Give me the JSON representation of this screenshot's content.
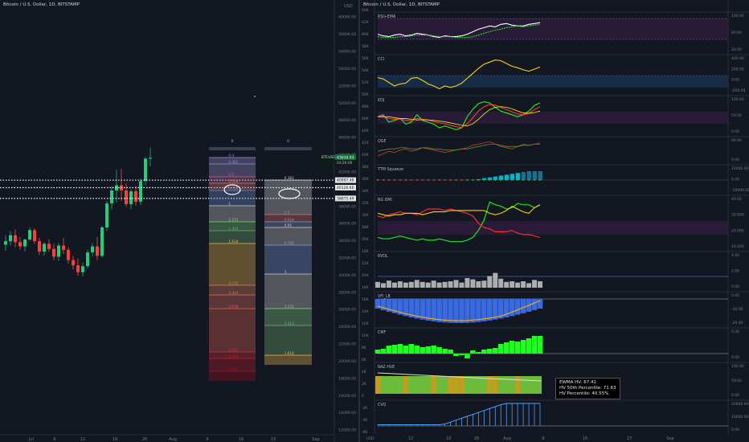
{
  "left_chart": {
    "title": "Bitcoin / U.S. Dollar, 1D, BITSTAMP",
    "currency": "USD",
    "ticker": "BTCUSD",
    "last_price": "43634.93",
    "countdown": "04:26:06",
    "price_tags": [
      "40997.48",
      "40126.60",
      "38875.49"
    ],
    "y_ticks": [
      "60000.00",
      "58000.00",
      "56000.00",
      "54000.00",
      "52000.00",
      "50000.00",
      "48000.00",
      "46000.00",
      "44000.00",
      "42000.00",
      "40000.00",
      "38000.00",
      "36000.00",
      "34000.00",
      "32000.00",
      "30000.00",
      "28000.00",
      "26000.00",
      "24000.00",
      "22000.00",
      "20000.00",
      "18000.00",
      "16000.00",
      "14000.00",
      "12000.00"
    ],
    "x_ticks": [
      "Jul",
      "6",
      "12",
      "19",
      "26",
      "Aug",
      "9",
      "16",
      "23",
      "Sep"
    ],
    "fib_left": {
      "top_label": "0",
      "levels": [
        "0.3",
        "0.382",
        "0.5",
        "0.618",
        "0.786",
        "1",
        "1.272",
        "1.414",
        "1.618",
        "2.272",
        "2.414",
        "2.618",
        "3.272",
        "3.414",
        "3.618"
      ]
    },
    "fib_right": {
      "top_label": "0",
      "levels": [
        "0.382",
        "0.5",
        "0.618",
        "0.65",
        "0.786",
        "1",
        "1.272",
        "1.414",
        "1.618"
      ]
    }
  },
  "right_chart": {
    "title": "Bitcoin / U.S. Dollar, 1D, BITSTAMP",
    "currency": "USD",
    "x_ticks": [
      "12",
      "19",
      "26",
      "Aug",
      "9",
      "16",
      "23",
      "Sep"
    ],
    "left_ticks": [
      "64K",
      "62K",
      "60K",
      "58K",
      "56K",
      "54K",
      "52K",
      "50K",
      "48K",
      "46K",
      "44K",
      "42K",
      "40K",
      "38K",
      "36K",
      "34K",
      "32K",
      "30K",
      "28K",
      "26K",
      "24K",
      "22K",
      "20K",
      "18K",
      "16K",
      "14K",
      "12K",
      "10K",
      "8K",
      "6K",
      "4K",
      "2K",
      "0",
      "-2K",
      "-4K",
      "-6K"
    ],
    "panes": [
      {
        "name": "RSI+EMA",
        "ticks": [
          "100.00",
          "80.00",
          "20.00"
        ]
      },
      {
        "name": "CCI",
        "ticks": [
          "400.00",
          "200.00",
          "0.00",
          "-200.00"
        ]
      },
      {
        "name": "KDJ",
        "ticks": [
          "100.00",
          "50.00",
          "0.00"
        ]
      },
      {
        "name": "OGE",
        "ticks": [
          "60.00",
          "0.00"
        ]
      },
      {
        "name": "TTM Squeeze",
        "ticks": [
          "10000.00",
          "0.00",
          "-10000.00"
        ]
      },
      {
        "name": "RG DMI",
        "ticks": [
          "40.00",
          "30.000",
          "20.000",
          "10.000"
        ]
      },
      {
        "name": "RVOL",
        "ticks": [
          "4.00",
          "2.00",
          "0.00"
        ]
      },
      {
        "name": "VFI_LB",
        "ticks": [
          "0.00",
          "-10.00",
          "-20.00"
        ]
      },
      {
        "name": "CMF",
        "ticks": [
          "0.20",
          "0.00"
        ]
      },
      {
        "name": "RAZ HVE",
        "ticks": [
          "100.00",
          "50.00",
          "0.00"
        ]
      },
      {
        "name": "CVO",
        "ticks": [
          "20000.00",
          "10000.00",
          "0.00"
        ]
      }
    ],
    "hve_box": {
      "line1": "EWMA HV: 67.41",
      "line2": "HV 50th Percentile: 71.63",
      "line3": "HV Percentile: 40.55%"
    }
  },
  "chart_data": [
    {
      "type": "candlestick",
      "title": "Bitcoin / U.S. Dollar, 1D, BITSTAMP",
      "ylim": [
        11500,
        61000
      ],
      "x_categories": [
        "Jul",
        "6",
        "12",
        "19",
        "26",
        "Aug",
        "9",
        "16",
        "23",
        "Sep"
      ],
      "candles": [
        [
          33500,
          34600,
          32800,
          33900
        ],
        [
          33900,
          35100,
          33400,
          34600
        ],
        [
          34600,
          35300,
          33200,
          33800
        ],
        [
          33800,
          34400,
          32900,
          33300
        ],
        [
          33300,
          34200,
          32700,
          34100
        ],
        [
          34100,
          35500,
          33900,
          35200
        ],
        [
          35200,
          35400,
          33600,
          33900
        ],
        [
          33900,
          34300,
          32300,
          32700
        ],
        [
          32700,
          33800,
          32200,
          33600
        ],
        [
          33600,
          34100,
          32700,
          33000
        ],
        [
          33000,
          33600,
          31700,
          32100
        ],
        [
          32100,
          33700,
          31600,
          33400
        ],
        [
          33400,
          34300,
          32400,
          32900
        ],
        [
          32900,
          33200,
          31300,
          31700
        ],
        [
          31700,
          32200,
          30600,
          31100
        ],
        [
          31100,
          31900,
          29900,
          30300
        ],
        [
          30300,
          31400,
          29800,
          31000
        ],
        [
          31000,
          32900,
          30700,
          32600
        ],
        [
          32600,
          33700,
          32100,
          33300
        ],
        [
          33300,
          34400,
          31700,
          32200
        ],
        [
          32200,
          35700,
          32000,
          35500
        ],
        [
          35500,
          38600,
          35100,
          38300
        ],
        [
          38300,
          40300,
          37600,
          39800
        ],
        [
          39800,
          42200,
          38400,
          40400
        ],
        [
          40400,
          42300,
          38600,
          39800
        ],
        [
          39800,
          40600,
          37900,
          38200
        ],
        [
          38200,
          39900,
          37600,
          39700
        ],
        [
          39700,
          40300,
          38000,
          38500
        ],
        [
          38500,
          41200,
          38100,
          40900
        ],
        [
          40900,
          43700,
          40400,
          43500
        ],
        [
          43500,
          44800,
          42600,
          43600
        ]
      ],
      "horizontal_levels": [
        40997.48,
        40126.6,
        38875.49
      ],
      "last_price": 43634.93
    },
    {
      "type": "line",
      "title": "RSI+EMA",
      "series": [
        {
          "values": [
            60,
            58,
            57,
            59,
            60,
            58,
            59,
            61,
            60,
            59,
            57,
            56,
            58,
            57,
            57,
            58,
            60,
            63,
            66,
            68,
            70,
            69,
            72,
            73,
            71,
            70,
            70,
            72,
            73,
            74
          ]
        },
        {
          "values": [
            57,
            56,
            56,
            56,
            57,
            57,
            58,
            59,
            59,
            59,
            58,
            57,
            57,
            57,
            56,
            56,
            56,
            57,
            59,
            61,
            63,
            65,
            66,
            68,
            69,
            70,
            69,
            70,
            71,
            72
          ]
        }
      ]
    },
    {
      "type": "line",
      "title": "CCI",
      "series": [
        {
          "values": [
            -20,
            -40,
            -90,
            -140,
            -110,
            -100,
            -30,
            -20,
            -60,
            -110,
            -140,
            -180,
            -140,
            -160,
            -140,
            -100,
            -30,
            40,
            110,
            170,
            200,
            230,
            220,
            180,
            140,
            120,
            90,
            70,
            100,
            130
          ]
        }
      ]
    },
    {
      "type": "line",
      "title": "KDJ",
      "series": [
        {
          "values": [
            55,
            60,
            40,
            45,
            50,
            35,
            40,
            60,
            45,
            40,
            35,
            25,
            30,
            25,
            20,
            25,
            55,
            75,
            90,
            95,
            92,
            80,
            70,
            65,
            60,
            55,
            60,
            70,
            85,
            92
          ]
        },
        {
          "values": [
            55,
            56,
            50,
            48,
            49,
            45,
            44,
            50,
            48,
            46,
            42,
            38,
            36,
            32,
            28,
            26,
            36,
            52,
            70,
            82,
            88,
            86,
            80,
            74,
            68,
            62,
            60,
            64,
            74,
            82
          ]
        },
        {
          "values": [
            55,
            54,
            55,
            52,
            50,
            50,
            48,
            46,
            47,
            46,
            45,
            43,
            41,
            38,
            35,
            32,
            30,
            36,
            48,
            62,
            74,
            80,
            82,
            80,
            76,
            70,
            65,
            64,
            66,
            70
          ]
        }
      ]
    },
    {
      "type": "line",
      "title": "RG DMI",
      "series": [
        {
          "values": [
            10,
            9,
            9,
            10,
            11,
            10,
            9,
            8,
            9,
            8,
            8,
            9,
            8,
            7,
            7,
            7,
            8,
            10,
            15,
            22,
            35,
            33,
            32,
            30,
            31,
            34,
            33,
            33,
            31,
            33
          ]
        },
        {
          "values": [
            25,
            24,
            26,
            27,
            28,
            27,
            27,
            26,
            28,
            30,
            30,
            30,
            29,
            30,
            29,
            28,
            27,
            25,
            20,
            17,
            16,
            14,
            14,
            14,
            15,
            13,
            12,
            12,
            11,
            10
          ]
        },
        {
          "values": [
            27,
            26,
            25,
            26,
            26,
            27,
            27,
            27,
            26,
            27,
            28,
            28,
            28,
            29,
            29,
            29,
            29,
            29,
            29,
            29,
            27,
            26,
            27,
            29,
            32,
            30,
            28,
            27,
            31,
            33
          ]
        }
      ]
    },
    {
      "type": "bar",
      "title": "RVOL",
      "values": [
        0.9,
        0.7,
        1.1,
        0.8,
        1.0,
        0.8,
        0.9,
        1.2,
        0.9,
        0.8,
        1.1,
        0.8,
        0.9,
        1.0,
        1.2,
        0.8,
        1.5,
        1.3,
        1.0,
        1.1,
        1.8,
        2.3,
        1.4,
        0.9,
        1.0,
        0.8,
        1.0,
        0.7,
        1.2,
        1.0
      ]
    },
    {
      "type": "bar",
      "title": "CMF",
      "values": [
        0.05,
        0.06,
        0.1,
        0.11,
        0.12,
        0.1,
        0.12,
        0.1,
        0.08,
        0.09,
        0.1,
        0.08,
        0.06,
        0.05,
        -0.03,
        -0.02,
        -0.06,
        0.04,
        0.02,
        0.05,
        0.06,
        0.07,
        0.12,
        0.14,
        0.16,
        0.15,
        0.17,
        0.19,
        0.22,
        0.22
      ]
    }
  ]
}
